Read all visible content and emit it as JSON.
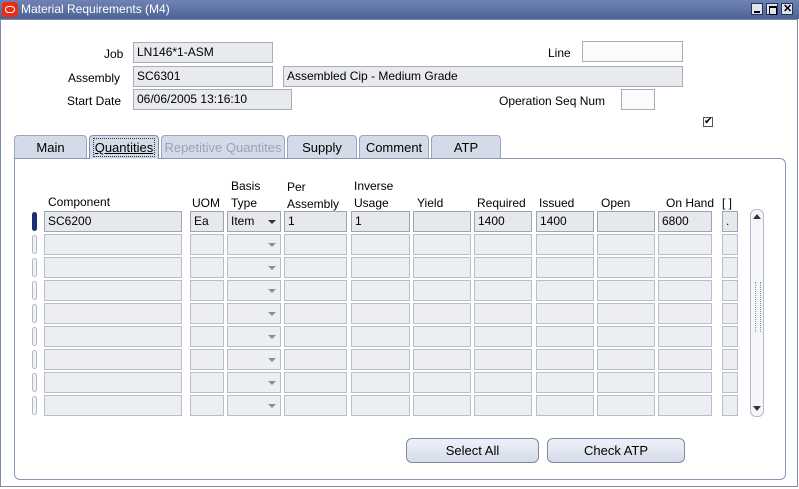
{
  "window": {
    "title": "Material Requirements (M4)",
    "minimize_icon": "minimize-icon",
    "maximize_icon": "maximize-icon",
    "close_icon": "close-icon"
  },
  "header": {
    "job_label": "Job",
    "job_value": "LN146*1-ASM",
    "assembly_label": "Assembly",
    "assembly_value": "SC6301",
    "assembly_description": "Assembled Cip - Medium Grade",
    "start_date_label": "Start Date",
    "start_date_value": "06/06/2005 13:16:10",
    "line_label": "Line",
    "line_value": "",
    "op_seq_label": "Operation Seq Num",
    "op_seq_value": "",
    "checkbox_checked": true
  },
  "tabs": [
    {
      "label": "Main",
      "state": "normal"
    },
    {
      "label": "Quantities",
      "state": "active"
    },
    {
      "label": "Repetitive Quantites",
      "state": "disabled"
    },
    {
      "label": "Supply",
      "state": "normal"
    },
    {
      "label": "Comment",
      "state": "normal"
    },
    {
      "label": "ATP",
      "state": "normal"
    }
  ],
  "table": {
    "headers": {
      "component": "Component",
      "uom": "UOM",
      "basis_1": "Basis",
      "basis_2": "Type",
      "per_1": "Per",
      "per_2": "Assembly",
      "inverse_1": "Inverse",
      "inverse_2": "Usage",
      "yield": "Yield",
      "required": "Required",
      "issued": "Issued",
      "open": "Open",
      "on_hand": "On Hand",
      "flex": "[ ]"
    },
    "rows": [
      {
        "component": "SC6200",
        "uom": "Ea",
        "basis_type": "Item",
        "per_assembly": "1",
        "inverse_usage": "1",
        "yield": "",
        "required": "1400",
        "issued": "1400",
        "open": "",
        "on_hand": "6800",
        "flex": "."
      },
      {
        "component": "",
        "uom": "",
        "basis_type": "",
        "per_assembly": "",
        "inverse_usage": "",
        "yield": "",
        "required": "",
        "issued": "",
        "open": "",
        "on_hand": "",
        "flex": ""
      },
      {
        "component": "",
        "uom": "",
        "basis_type": "",
        "per_assembly": "",
        "inverse_usage": "",
        "yield": "",
        "required": "",
        "issued": "",
        "open": "",
        "on_hand": "",
        "flex": ""
      },
      {
        "component": "",
        "uom": "",
        "basis_type": "",
        "per_assembly": "",
        "inverse_usage": "",
        "yield": "",
        "required": "",
        "issued": "",
        "open": "",
        "on_hand": "",
        "flex": ""
      },
      {
        "component": "",
        "uom": "",
        "basis_type": "",
        "per_assembly": "",
        "inverse_usage": "",
        "yield": "",
        "required": "",
        "issued": "",
        "open": "",
        "on_hand": "",
        "flex": ""
      },
      {
        "component": "",
        "uom": "",
        "basis_type": "",
        "per_assembly": "",
        "inverse_usage": "",
        "yield": "",
        "required": "",
        "issued": "",
        "open": "",
        "on_hand": "",
        "flex": ""
      },
      {
        "component": "",
        "uom": "",
        "basis_type": "",
        "per_assembly": "",
        "inverse_usage": "",
        "yield": "",
        "required": "",
        "issued": "",
        "open": "",
        "on_hand": "",
        "flex": ""
      },
      {
        "component": "",
        "uom": "",
        "basis_type": "",
        "per_assembly": "",
        "inverse_usage": "",
        "yield": "",
        "required": "",
        "issued": "",
        "open": "",
        "on_hand": "",
        "flex": ""
      },
      {
        "component": "",
        "uom": "",
        "basis_type": "",
        "per_assembly": "",
        "inverse_usage": "",
        "yield": "",
        "required": "",
        "issued": "",
        "open": "",
        "on_hand": "",
        "flex": ""
      }
    ]
  },
  "buttons": {
    "select_all": "Select All",
    "check_atp": "Check ATP"
  },
  "colors": {
    "titlebar": "#4d6394",
    "tab_bg": "#d4dbe8",
    "current_row_indicator": "#1f2f6e"
  }
}
